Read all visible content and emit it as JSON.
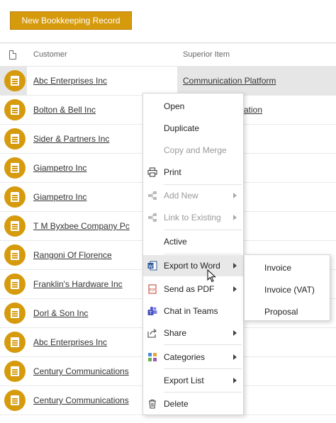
{
  "toolbar": {
    "new_record_label": "New Bookkeeping Record"
  },
  "header": {
    "customer": "Customer",
    "superior_item": "Superior Item"
  },
  "rows": [
    {
      "customer": "Abc Enterprises Inc",
      "superior": "Communication Platform"
    },
    {
      "customer": "Bolton & Bell Inc",
      "superior_partial": "ation"
    },
    {
      "customer": "Sider & Partners Inc"
    },
    {
      "customer": "Giampetro Inc"
    },
    {
      "customer": "Giampetro Inc"
    },
    {
      "customer": "T M Byxbee Company Pc"
    },
    {
      "customer": "Rangoni Of Florence"
    },
    {
      "customer": "Franklin's Hardware Inc"
    },
    {
      "customer": "Dorl & Son Inc"
    },
    {
      "customer": "Abc Enterprises Inc"
    },
    {
      "customer": "Century Communications"
    },
    {
      "customer": "Century Communications"
    }
  ],
  "context_menu": {
    "open": "Open",
    "duplicate": "Duplicate",
    "copy_merge": "Copy and Merge",
    "print": "Print",
    "add_new": "Add New",
    "link_existing": "Link to Existing",
    "active": "Active",
    "export_word": "Export to Word",
    "send_pdf": "Send as PDF",
    "chat_teams": "Chat in Teams",
    "share": "Share",
    "categories": "Categories",
    "export_list": "Export List",
    "delete": "Delete"
  },
  "export_submenu": {
    "invoice": "Invoice",
    "invoice_vat": "Invoice (VAT)",
    "proposal": "Proposal"
  },
  "colors": {
    "accent": "#d69a0d",
    "selected_row": "#e6e6e6",
    "menu_hover": "#e8e8e8"
  }
}
